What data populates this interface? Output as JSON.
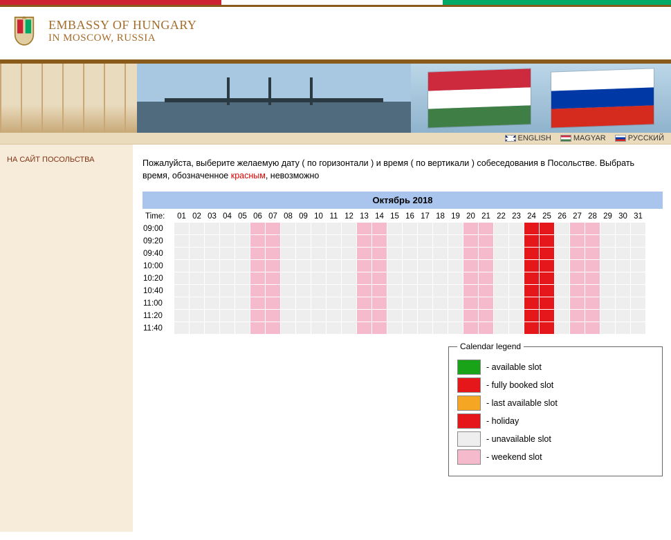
{
  "header": {
    "line1": "EMBASSY OF HUNGARY",
    "line2": "IN MOSCOW, RUSSIA"
  },
  "lang": {
    "en": "ENGLISH",
    "hu": "MAGYAR",
    "ru": "РУССКИЙ"
  },
  "sidebar": {
    "back": "НА САЙТ ПОСОЛЬСТВА"
  },
  "instr": {
    "p1a": "Пожалуйста, выберите желаемую дату ( по горизонтали ) и время ( по вертикали ) собеседования в Посольстве. Выбрать время, обозначенное ",
    "red": "красным",
    "p1b": ", невозможно"
  },
  "calendar": {
    "month": "Октябрь 2018",
    "timeLabel": "Time:",
    "days": [
      "01",
      "02",
      "03",
      "04",
      "05",
      "06",
      "07",
      "08",
      "09",
      "10",
      "11",
      "12",
      "13",
      "14",
      "15",
      "16",
      "17",
      "18",
      "19",
      "20",
      "21",
      "22",
      "23",
      "24",
      "25",
      "26",
      "27",
      "28",
      "29",
      "30",
      "31"
    ],
    "times": [
      "09:00",
      "09:20",
      "09:40",
      "10:00",
      "10:20",
      "10:40",
      "11:00",
      "11:20",
      "11:40"
    ],
    "dayStatus": [
      "u",
      "u",
      "u",
      "u",
      "u",
      "p",
      "p",
      "u",
      "u",
      "u",
      "u",
      "u",
      "p",
      "p",
      "u",
      "u",
      "u",
      "u",
      "u",
      "p",
      "p",
      "u",
      "u",
      "r",
      "r",
      "u",
      "p",
      "p",
      "u",
      "u",
      "u"
    ]
  },
  "legend": {
    "title": "Calendar legend",
    "items": [
      {
        "cls": "s-green",
        "label": "- available slot"
      },
      {
        "cls": "s-red",
        "label": "- fully booked slot"
      },
      {
        "cls": "s-orange",
        "label": "- last available slot"
      },
      {
        "cls": "s-red",
        "label": "- holiday"
      },
      {
        "cls": "s-grey",
        "label": "- unavailable slot"
      },
      {
        "cls": "s-pink",
        "label": "- weekend slot"
      }
    ]
  }
}
